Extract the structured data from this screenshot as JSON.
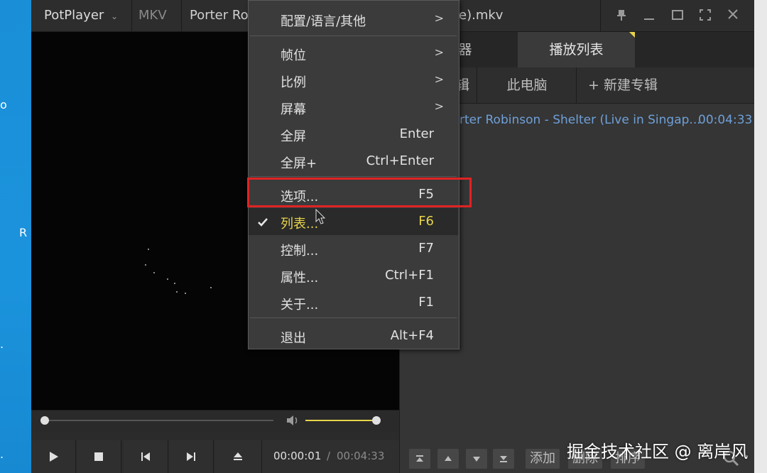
{
  "desktop": {
    "labels": [
      "o",
      "R",
      ".",
      "."
    ]
  },
  "titlebar": {
    "app": "PotPlayer",
    "format": "MKV",
    "file_prefix": "Porter Ro",
    "file_suffix": "e).mkv"
  },
  "menu": {
    "items": [
      {
        "label": "配置/语言/其他",
        "shortcut": "",
        "submenu": ">"
      },
      {
        "label": "帧位",
        "shortcut": "",
        "submenu": ">"
      },
      {
        "label": "比例",
        "shortcut": "",
        "submenu": ">"
      },
      {
        "label": "屏幕",
        "shortcut": "",
        "submenu": ">"
      },
      {
        "label": "全屏",
        "shortcut": "Enter",
        "submenu": ""
      },
      {
        "label": "全屏+",
        "shortcut": "Ctrl+Enter",
        "submenu": ""
      },
      {
        "label": "选项...",
        "shortcut": "F5",
        "submenu": ""
      },
      {
        "label": "列表...",
        "shortcut": "F6",
        "submenu": ""
      },
      {
        "label": "控制...",
        "shortcut": "F7",
        "submenu": ""
      },
      {
        "label": "属性...",
        "shortcut": "Ctrl+F1",
        "submenu": ""
      },
      {
        "label": "关于...",
        "shortcut": "F1",
        "submenu": ""
      },
      {
        "label": "退出",
        "shortcut": "Alt+F4",
        "submenu": ""
      }
    ]
  },
  "playlist": {
    "tab_left": "览器",
    "tab_active": "播放列表",
    "subtab_left": "辑",
    "subtab_pc": "此电脑",
    "subtab_new": "+ 新建专辑",
    "row_title": "rter Robinson - Shelter (Live in Singap...",
    "row_duration": "00:04:33",
    "add": "添加",
    "delete": "删除",
    "sort": "排序"
  },
  "controls": {
    "time_current": "00:00:01",
    "time_sep": "/",
    "time_total": "00:04:33",
    "progress_fraction": 0.01,
    "volume_fraction": 1.0
  },
  "watermark": "掘金技术社区 @ 离岸风",
  "colors": {
    "highlight": "#e8d44a",
    "annotation": "#e02323",
    "link": "#6fa0d8"
  }
}
